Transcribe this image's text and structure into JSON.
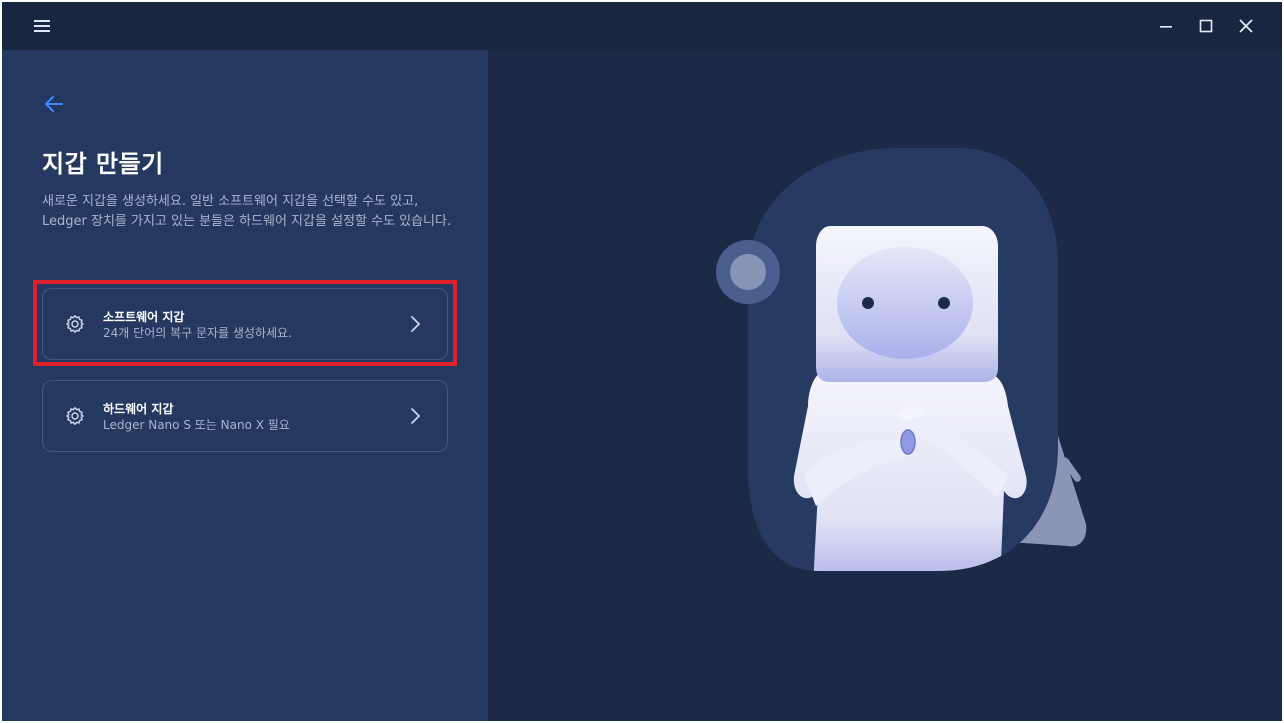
{
  "titlebar": {
    "menu_icon": "hamburger-icon",
    "controls": [
      "minimize-icon",
      "maximize-icon",
      "close-icon"
    ]
  },
  "left": {
    "back_icon": "arrow-left-icon",
    "title": "지갑 만들기",
    "description": "새로운 지갑을 생성하세요. 일반 소프트웨어 지갑을 선택할 수도 있고, Ledger 장치를 가지고 있는 분들은 하드웨어 지갑을 설정할 수도 있습니다.",
    "options": [
      {
        "title": "소프트웨어 지갑",
        "subtitle": "24개 단어의 복구 문자를 생성하세요.",
        "icon": "settings-gear-icon"
      },
      {
        "title": "하드웨어 지갑",
        "subtitle": "Ledger Nano S 또는 Nano X 필요",
        "icon": "settings-gear-icon"
      }
    ]
  },
  "colors": {
    "window_bg": "#1b2a46",
    "panel_bg": "#253860",
    "accent": "#3b8bff",
    "highlight": "#e0202a"
  }
}
